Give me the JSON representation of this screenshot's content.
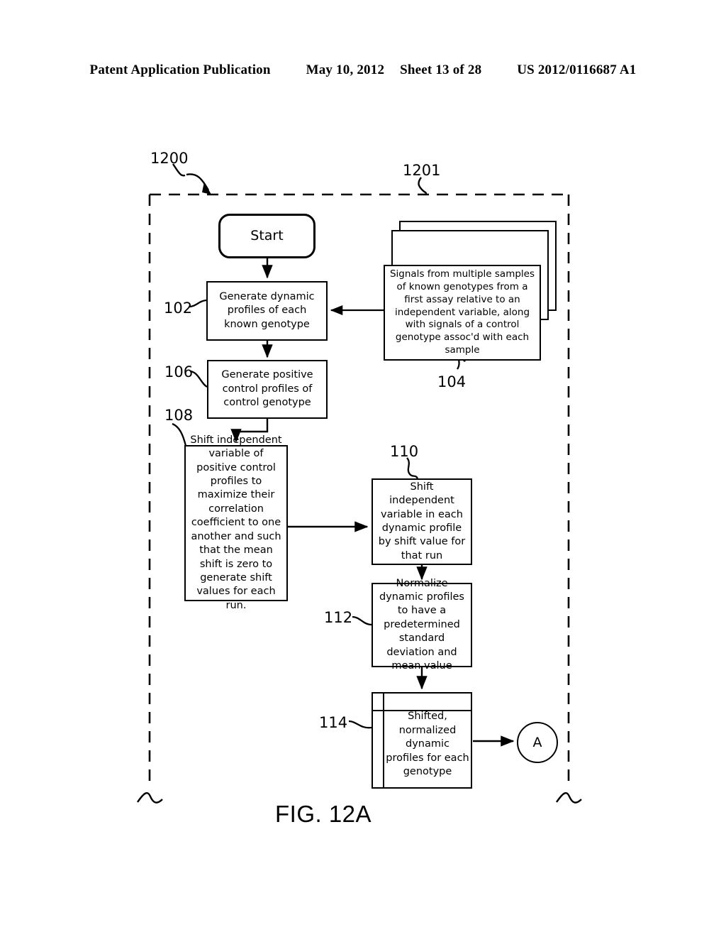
{
  "header": {
    "publication": "Patent Application Publication",
    "date": "May 10, 2012",
    "sheet": "Sheet 13 of 28",
    "docnum": "US 2012/0116687 A1"
  },
  "figure": {
    "caption": "FIG. 12A",
    "boundary_ref": "1201",
    "diagram_ref": "1200"
  },
  "nodes": {
    "start": {
      "label": "Start",
      "shape": "rounded-terminator"
    },
    "n102": {
      "ref": "102",
      "label": "Generate dynamic profiles of each known genotype",
      "shape": "process"
    },
    "n104": {
      "ref": "104",
      "label": "Signals from multiple samples of known genotypes from a first assay relative to an independent variable, along with signals of a control genotype assoc'd with each sample",
      "shape": "stacked-document"
    },
    "n106": {
      "ref": "106",
      "label": "Generate positive control profiles of control genotype",
      "shape": "process"
    },
    "n108": {
      "ref": "108",
      "label": "Shift independent variable of positive control profiles to maximize their correlation coefficient to one another and such that the mean shift is zero to generate shift values for each run.",
      "shape": "process"
    },
    "n110": {
      "ref": "110",
      "label": "Shift independent variable in each dynamic profile by shift value for that run",
      "shape": "process"
    },
    "n112": {
      "ref": "112",
      "label": "Normalize dynamic profiles to have a predetermined standard deviation and mean value",
      "shape": "process"
    },
    "n114": {
      "ref": "114",
      "label": "Shifted, normalized dynamic profiles for each genotype",
      "shape": "data-store"
    },
    "connector_a": {
      "label": "A",
      "shape": "circle-connector"
    }
  },
  "colors": {
    "stroke": "#000000",
    "background": "#ffffff"
  }
}
